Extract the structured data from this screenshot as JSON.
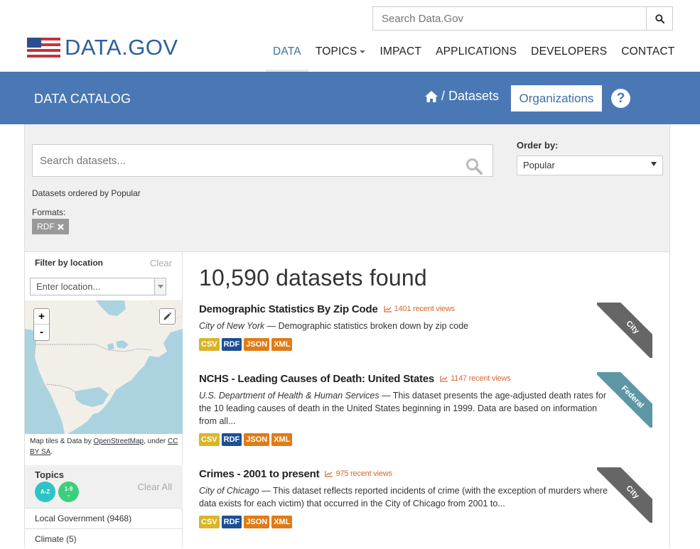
{
  "header": {
    "logo_text": "DATA.GOV",
    "search_placeholder": "Search Data.Gov",
    "nav": [
      {
        "label": "DATA",
        "active": true
      },
      {
        "label": "TOPICS",
        "has_dropdown": true
      },
      {
        "label": "IMPACT"
      },
      {
        "label": "APPLICATIONS"
      },
      {
        "label": "DEVELOPERS"
      },
      {
        "label": "CONTACT"
      }
    ]
  },
  "bluebar": {
    "title": "DATA CATALOG",
    "breadcrumb_sep": "/",
    "breadcrumb_current": "Datasets",
    "organizations_label": "Organizations",
    "help_label": "?"
  },
  "search": {
    "placeholder": "Search datasets...",
    "order_label": "Order by:",
    "order_value": "Popular",
    "ordered_by_text": "Datasets ordered by Popular",
    "formats_label": "Formats:",
    "format_tag": "RDF"
  },
  "sidebar": {
    "filter_location_title": "Filter by location",
    "filter_location_clear": "Clear",
    "location_placeholder": "Enter location...",
    "zoom_in": "+",
    "zoom_out": "-",
    "attribution_prefix": "Map tiles & Data by ",
    "attribution_link1": "OpenStreetMap",
    "attribution_mid": ", under ",
    "attribution_link2": "CC BY SA",
    "attribution_suffix": ".",
    "topics_title": "Topics",
    "topics_az": "A-Z",
    "topics_19": "1-9",
    "topics_clear": "Clear All",
    "topics": [
      {
        "label": "Local Government (9468)"
      },
      {
        "label": "Climate (5)"
      }
    ]
  },
  "results": {
    "found_text": "10,590 datasets found",
    "datasets": [
      {
        "title": "Demographic Statistics By Zip Code",
        "views": "1401 recent views",
        "org": "City of New York",
        "desc": " — Demographic statistics broken down by zip code",
        "formats": [
          "CSV",
          "RDF",
          "JSON",
          "XML"
        ],
        "ribbon": "City"
      },
      {
        "title": "NCHS - Leading Causes of Death: United States",
        "views": "1147 recent views",
        "org": "U.S. Department of Health & Human Services",
        "desc": " — This dataset presents the age-adjusted death rates for the 10 leading causes of death in the United States beginning in 1999. Data are based on information from all...",
        "formats": [
          "CSV",
          "RDF",
          "JSON",
          "XML"
        ],
        "ribbon": "Federal"
      },
      {
        "title": "Crimes - 2001 to present",
        "views": "975 recent views",
        "org": "City of Chicago",
        "desc": " — This dataset reflects reported incidents of crime (with the exception of murders where data exists for each victim) that occurred in the City of Chicago from 2001 to...",
        "formats": [
          "CSV",
          "RDF",
          "JSON",
          "XML"
        ],
        "ribbon": "City"
      }
    ]
  },
  "colors": {
    "brand_blue": "#4a78b5",
    "views_orange": "#d9662a",
    "csv": "#d9b52a",
    "rdf": "#1e4f96",
    "json": "#e07b16",
    "xml": "#e07b16"
  }
}
